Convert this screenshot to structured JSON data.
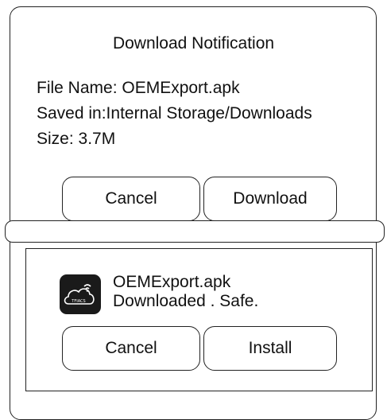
{
  "dialog": {
    "title": "Download Notification",
    "file_name": "File Name: OEMExport.apk",
    "saved_in": "Saved in:Internal Storage/Downloads",
    "size": "Size: 3.7M",
    "cancel_label": "Cancel",
    "download_label": "Download"
  },
  "notification": {
    "app_icon": "cloud-wifi-icon",
    "app_icon_text": "TFIACS",
    "file_name": "OEMExport.apk",
    "status": "Downloaded . Safe.",
    "cancel_label": "Cancel",
    "install_label": "Install"
  },
  "colors": {
    "border": "#222222",
    "text": "#111111",
    "icon_bg": "#1a1a1a"
  }
}
